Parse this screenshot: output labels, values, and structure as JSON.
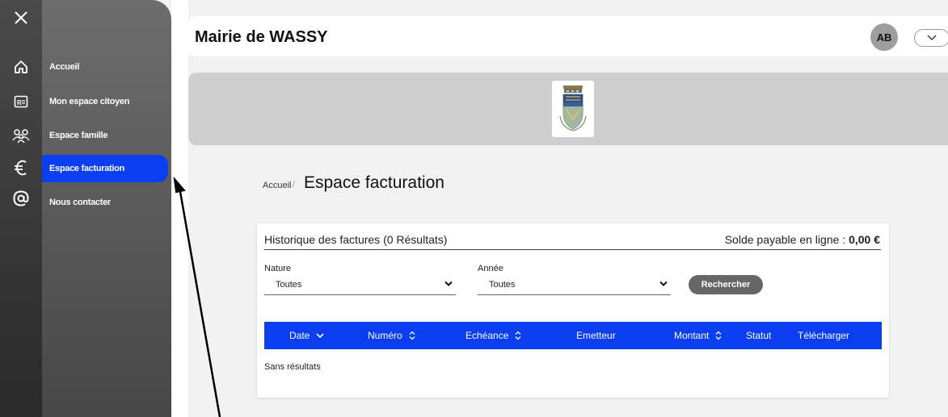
{
  "rail": {
    "icons": [
      "close-icon",
      "home-icon",
      "id-card-icon",
      "family-icon",
      "euro-icon",
      "at-icon"
    ]
  },
  "menu": {
    "items": [
      {
        "label": "Accueil"
      },
      {
        "label": "Mon espace citoyen"
      },
      {
        "label": "Espace famille"
      },
      {
        "label": "Espace facturation",
        "active": true
      },
      {
        "label": "Nous contacter"
      }
    ]
  },
  "header": {
    "title": "Mairie de WASSY",
    "avatar": "AB"
  },
  "breadcrumb": {
    "home": "Accueil",
    "separator": "/",
    "current": "Espace facturation"
  },
  "invoices": {
    "history_title": "Historique des factures (0 Résultats)",
    "balance_label": "Solde payable en ligne :",
    "balance_value": "0,00 €",
    "filters": {
      "nature_label": "Nature",
      "nature_value": "Toutes",
      "year_label": "Année",
      "year_value": "Toutes",
      "search_button": "Rechercher"
    },
    "columns": [
      "Date",
      "Numéro",
      "Echéance",
      "Emetteur",
      "Montant",
      "Statut",
      "Télécharger"
    ],
    "empty_text": "Sans résultats"
  },
  "colors": {
    "accent": "#0b3ef0",
    "menu_bg": "#5f5f5f",
    "banner_bg": "#cfcfcf"
  }
}
